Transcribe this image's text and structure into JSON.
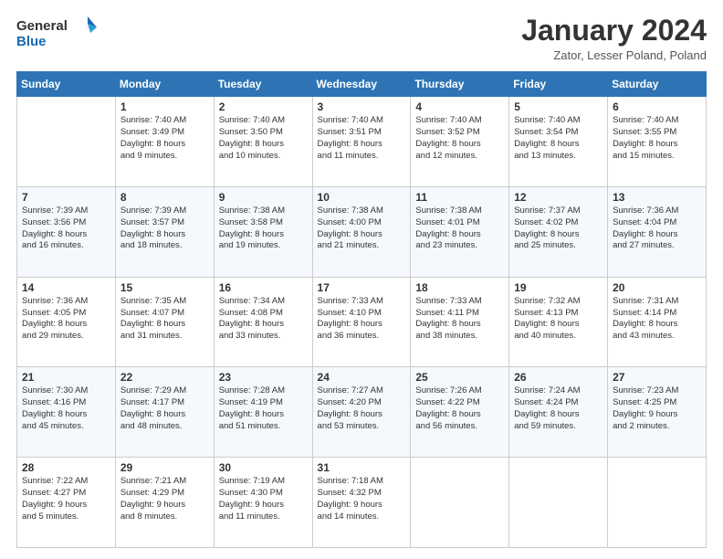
{
  "logo": {
    "line1": "General",
    "line2": "Blue"
  },
  "header": {
    "title": "January 2024",
    "location": "Zator, Lesser Poland, Poland"
  },
  "weekdays": [
    "Sunday",
    "Monday",
    "Tuesday",
    "Wednesday",
    "Thursday",
    "Friday",
    "Saturday"
  ],
  "weeks": [
    [
      {
        "day": "",
        "content": ""
      },
      {
        "day": "1",
        "content": "Sunrise: 7:40 AM\nSunset: 3:49 PM\nDaylight: 8 hours\nand 9 minutes."
      },
      {
        "day": "2",
        "content": "Sunrise: 7:40 AM\nSunset: 3:50 PM\nDaylight: 8 hours\nand 10 minutes."
      },
      {
        "day": "3",
        "content": "Sunrise: 7:40 AM\nSunset: 3:51 PM\nDaylight: 8 hours\nand 11 minutes."
      },
      {
        "day": "4",
        "content": "Sunrise: 7:40 AM\nSunset: 3:52 PM\nDaylight: 8 hours\nand 12 minutes."
      },
      {
        "day": "5",
        "content": "Sunrise: 7:40 AM\nSunset: 3:54 PM\nDaylight: 8 hours\nand 13 minutes."
      },
      {
        "day": "6",
        "content": "Sunrise: 7:40 AM\nSunset: 3:55 PM\nDaylight: 8 hours\nand 15 minutes."
      }
    ],
    [
      {
        "day": "7",
        "content": "Sunrise: 7:39 AM\nSunset: 3:56 PM\nDaylight: 8 hours\nand 16 minutes."
      },
      {
        "day": "8",
        "content": "Sunrise: 7:39 AM\nSunset: 3:57 PM\nDaylight: 8 hours\nand 18 minutes."
      },
      {
        "day": "9",
        "content": "Sunrise: 7:38 AM\nSunset: 3:58 PM\nDaylight: 8 hours\nand 19 minutes."
      },
      {
        "day": "10",
        "content": "Sunrise: 7:38 AM\nSunset: 4:00 PM\nDaylight: 8 hours\nand 21 minutes."
      },
      {
        "day": "11",
        "content": "Sunrise: 7:38 AM\nSunset: 4:01 PM\nDaylight: 8 hours\nand 23 minutes."
      },
      {
        "day": "12",
        "content": "Sunrise: 7:37 AM\nSunset: 4:02 PM\nDaylight: 8 hours\nand 25 minutes."
      },
      {
        "day": "13",
        "content": "Sunrise: 7:36 AM\nSunset: 4:04 PM\nDaylight: 8 hours\nand 27 minutes."
      }
    ],
    [
      {
        "day": "14",
        "content": "Sunrise: 7:36 AM\nSunset: 4:05 PM\nDaylight: 8 hours\nand 29 minutes."
      },
      {
        "day": "15",
        "content": "Sunrise: 7:35 AM\nSunset: 4:07 PM\nDaylight: 8 hours\nand 31 minutes."
      },
      {
        "day": "16",
        "content": "Sunrise: 7:34 AM\nSunset: 4:08 PM\nDaylight: 8 hours\nand 33 minutes."
      },
      {
        "day": "17",
        "content": "Sunrise: 7:33 AM\nSunset: 4:10 PM\nDaylight: 8 hours\nand 36 minutes."
      },
      {
        "day": "18",
        "content": "Sunrise: 7:33 AM\nSunset: 4:11 PM\nDaylight: 8 hours\nand 38 minutes."
      },
      {
        "day": "19",
        "content": "Sunrise: 7:32 AM\nSunset: 4:13 PM\nDaylight: 8 hours\nand 40 minutes."
      },
      {
        "day": "20",
        "content": "Sunrise: 7:31 AM\nSunset: 4:14 PM\nDaylight: 8 hours\nand 43 minutes."
      }
    ],
    [
      {
        "day": "21",
        "content": "Sunrise: 7:30 AM\nSunset: 4:16 PM\nDaylight: 8 hours\nand 45 minutes."
      },
      {
        "day": "22",
        "content": "Sunrise: 7:29 AM\nSunset: 4:17 PM\nDaylight: 8 hours\nand 48 minutes."
      },
      {
        "day": "23",
        "content": "Sunrise: 7:28 AM\nSunset: 4:19 PM\nDaylight: 8 hours\nand 51 minutes."
      },
      {
        "day": "24",
        "content": "Sunrise: 7:27 AM\nSunset: 4:20 PM\nDaylight: 8 hours\nand 53 minutes."
      },
      {
        "day": "25",
        "content": "Sunrise: 7:26 AM\nSunset: 4:22 PM\nDaylight: 8 hours\nand 56 minutes."
      },
      {
        "day": "26",
        "content": "Sunrise: 7:24 AM\nSunset: 4:24 PM\nDaylight: 8 hours\nand 59 minutes."
      },
      {
        "day": "27",
        "content": "Sunrise: 7:23 AM\nSunset: 4:25 PM\nDaylight: 9 hours\nand 2 minutes."
      }
    ],
    [
      {
        "day": "28",
        "content": "Sunrise: 7:22 AM\nSunset: 4:27 PM\nDaylight: 9 hours\nand 5 minutes."
      },
      {
        "day": "29",
        "content": "Sunrise: 7:21 AM\nSunset: 4:29 PM\nDaylight: 9 hours\nand 8 minutes."
      },
      {
        "day": "30",
        "content": "Sunrise: 7:19 AM\nSunset: 4:30 PM\nDaylight: 9 hours\nand 11 minutes."
      },
      {
        "day": "31",
        "content": "Sunrise: 7:18 AM\nSunset: 4:32 PM\nDaylight: 9 hours\nand 14 minutes."
      },
      {
        "day": "",
        "content": ""
      },
      {
        "day": "",
        "content": ""
      },
      {
        "day": "",
        "content": ""
      }
    ]
  ]
}
